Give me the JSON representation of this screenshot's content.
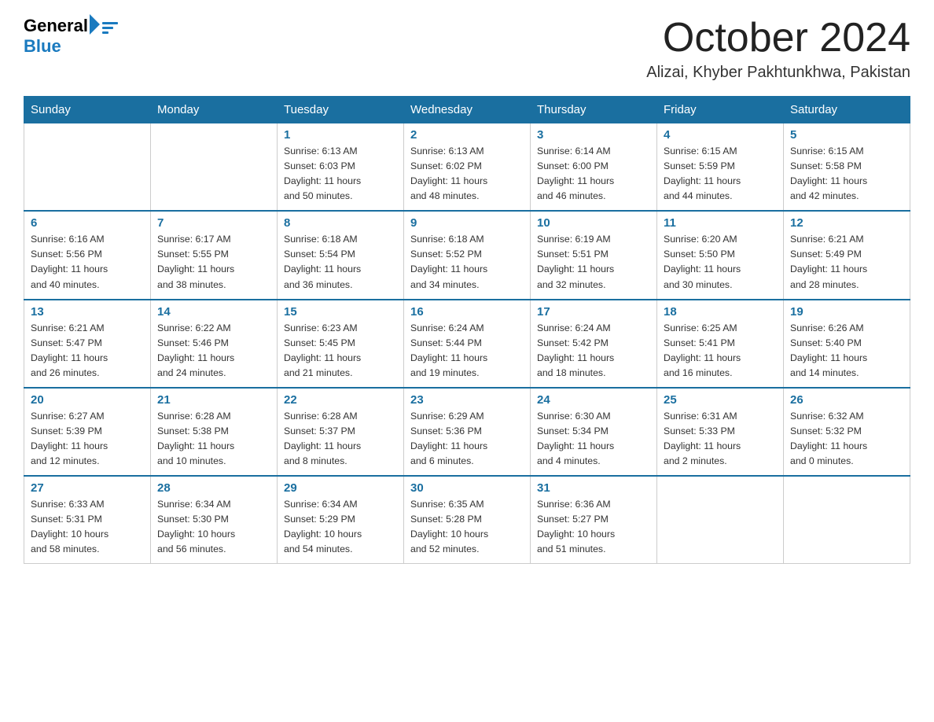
{
  "header": {
    "logo": {
      "text_general": "General",
      "text_blue": "Blue"
    },
    "title": "October 2024",
    "location": "Alizai, Khyber Pakhtunkhwa, Pakistan"
  },
  "calendar": {
    "days_of_week": [
      "Sunday",
      "Monday",
      "Tuesday",
      "Wednesday",
      "Thursday",
      "Friday",
      "Saturday"
    ],
    "weeks": [
      [
        {
          "day": "",
          "info": ""
        },
        {
          "day": "",
          "info": ""
        },
        {
          "day": "1",
          "info": "Sunrise: 6:13 AM\nSunset: 6:03 PM\nDaylight: 11 hours\nand 50 minutes."
        },
        {
          "day": "2",
          "info": "Sunrise: 6:13 AM\nSunset: 6:02 PM\nDaylight: 11 hours\nand 48 minutes."
        },
        {
          "day": "3",
          "info": "Sunrise: 6:14 AM\nSunset: 6:00 PM\nDaylight: 11 hours\nand 46 minutes."
        },
        {
          "day": "4",
          "info": "Sunrise: 6:15 AM\nSunset: 5:59 PM\nDaylight: 11 hours\nand 44 minutes."
        },
        {
          "day": "5",
          "info": "Sunrise: 6:15 AM\nSunset: 5:58 PM\nDaylight: 11 hours\nand 42 minutes."
        }
      ],
      [
        {
          "day": "6",
          "info": "Sunrise: 6:16 AM\nSunset: 5:56 PM\nDaylight: 11 hours\nand 40 minutes."
        },
        {
          "day": "7",
          "info": "Sunrise: 6:17 AM\nSunset: 5:55 PM\nDaylight: 11 hours\nand 38 minutes."
        },
        {
          "day": "8",
          "info": "Sunrise: 6:18 AM\nSunset: 5:54 PM\nDaylight: 11 hours\nand 36 minutes."
        },
        {
          "day": "9",
          "info": "Sunrise: 6:18 AM\nSunset: 5:52 PM\nDaylight: 11 hours\nand 34 minutes."
        },
        {
          "day": "10",
          "info": "Sunrise: 6:19 AM\nSunset: 5:51 PM\nDaylight: 11 hours\nand 32 minutes."
        },
        {
          "day": "11",
          "info": "Sunrise: 6:20 AM\nSunset: 5:50 PM\nDaylight: 11 hours\nand 30 minutes."
        },
        {
          "day": "12",
          "info": "Sunrise: 6:21 AM\nSunset: 5:49 PM\nDaylight: 11 hours\nand 28 minutes."
        }
      ],
      [
        {
          "day": "13",
          "info": "Sunrise: 6:21 AM\nSunset: 5:47 PM\nDaylight: 11 hours\nand 26 minutes."
        },
        {
          "day": "14",
          "info": "Sunrise: 6:22 AM\nSunset: 5:46 PM\nDaylight: 11 hours\nand 24 minutes."
        },
        {
          "day": "15",
          "info": "Sunrise: 6:23 AM\nSunset: 5:45 PM\nDaylight: 11 hours\nand 21 minutes."
        },
        {
          "day": "16",
          "info": "Sunrise: 6:24 AM\nSunset: 5:44 PM\nDaylight: 11 hours\nand 19 minutes."
        },
        {
          "day": "17",
          "info": "Sunrise: 6:24 AM\nSunset: 5:42 PM\nDaylight: 11 hours\nand 18 minutes."
        },
        {
          "day": "18",
          "info": "Sunrise: 6:25 AM\nSunset: 5:41 PM\nDaylight: 11 hours\nand 16 minutes."
        },
        {
          "day": "19",
          "info": "Sunrise: 6:26 AM\nSunset: 5:40 PM\nDaylight: 11 hours\nand 14 minutes."
        }
      ],
      [
        {
          "day": "20",
          "info": "Sunrise: 6:27 AM\nSunset: 5:39 PM\nDaylight: 11 hours\nand 12 minutes."
        },
        {
          "day": "21",
          "info": "Sunrise: 6:28 AM\nSunset: 5:38 PM\nDaylight: 11 hours\nand 10 minutes."
        },
        {
          "day": "22",
          "info": "Sunrise: 6:28 AM\nSunset: 5:37 PM\nDaylight: 11 hours\nand 8 minutes."
        },
        {
          "day": "23",
          "info": "Sunrise: 6:29 AM\nSunset: 5:36 PM\nDaylight: 11 hours\nand 6 minutes."
        },
        {
          "day": "24",
          "info": "Sunrise: 6:30 AM\nSunset: 5:34 PM\nDaylight: 11 hours\nand 4 minutes."
        },
        {
          "day": "25",
          "info": "Sunrise: 6:31 AM\nSunset: 5:33 PM\nDaylight: 11 hours\nand 2 minutes."
        },
        {
          "day": "26",
          "info": "Sunrise: 6:32 AM\nSunset: 5:32 PM\nDaylight: 11 hours\nand 0 minutes."
        }
      ],
      [
        {
          "day": "27",
          "info": "Sunrise: 6:33 AM\nSunset: 5:31 PM\nDaylight: 10 hours\nand 58 minutes."
        },
        {
          "day": "28",
          "info": "Sunrise: 6:34 AM\nSunset: 5:30 PM\nDaylight: 10 hours\nand 56 minutes."
        },
        {
          "day": "29",
          "info": "Sunrise: 6:34 AM\nSunset: 5:29 PM\nDaylight: 10 hours\nand 54 minutes."
        },
        {
          "day": "30",
          "info": "Sunrise: 6:35 AM\nSunset: 5:28 PM\nDaylight: 10 hours\nand 52 minutes."
        },
        {
          "day": "31",
          "info": "Sunrise: 6:36 AM\nSunset: 5:27 PM\nDaylight: 10 hours\nand 51 minutes."
        },
        {
          "day": "",
          "info": ""
        },
        {
          "day": "",
          "info": ""
        }
      ]
    ]
  }
}
